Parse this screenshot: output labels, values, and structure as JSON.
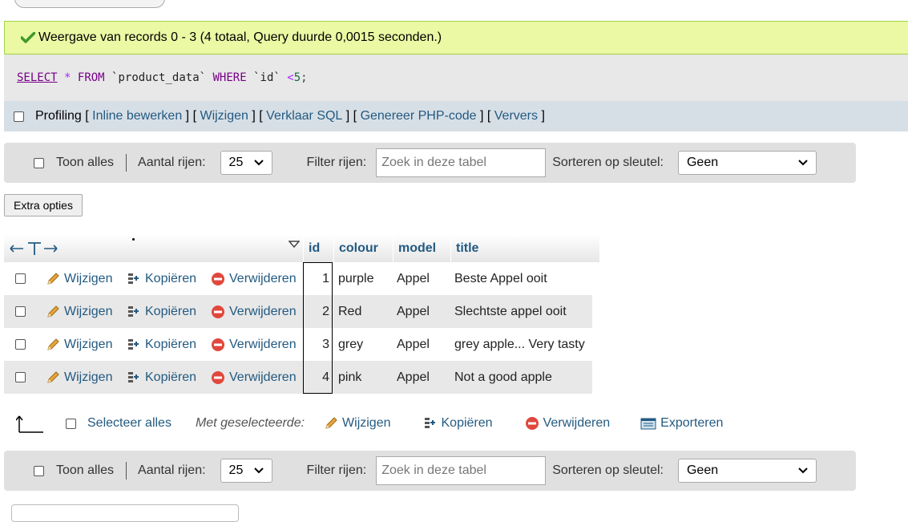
{
  "success": {
    "message": "Weergave van records 0 - 3 (4 totaal, Query duurde 0,0015 seconden.)"
  },
  "sql": {
    "select": "SELECT",
    "star": "*",
    "from": "FROM",
    "table": "`product_data`",
    "where": "WHERE",
    "column": "`id`",
    "operator": "<",
    "value": "5",
    "end": ";"
  },
  "profiling": {
    "label": "Profiling",
    "links": [
      "Inline bewerken",
      "Wijzigen",
      "Verklaar SQL",
      "Genereer PHP-code",
      "Ververs"
    ]
  },
  "nav": {
    "show_all": "Toon alles",
    "rows_label": "Aantal rijen:",
    "rows_value": "25",
    "filter_label": "Filter rijen:",
    "filter_placeholder": "Zoek in deze tabel",
    "sort_label": "Sorteren op sleutel:",
    "sort_value": "Geen"
  },
  "extra_options": "Extra opties",
  "table": {
    "columns": [
      "id",
      "colour",
      "model",
      "title"
    ],
    "actions": {
      "edit": "Wijzigen",
      "copy": "Kopiëren",
      "delete": "Verwijderen"
    },
    "rows": [
      {
        "id": "1",
        "colour": "purple",
        "model": "Appel",
        "title": "Beste Appel ooit"
      },
      {
        "id": "2",
        "colour": "Red",
        "model": "Appel",
        "title": "Slechtste appel ooit"
      },
      {
        "id": "3",
        "colour": "grey",
        "model": "Appel",
        "title": "grey apple... Very tasty"
      },
      {
        "id": "4",
        "colour": "pink",
        "model": "Appel",
        "title": "Not a good apple"
      }
    ]
  },
  "bulk": {
    "select_all": "Selecteer alles",
    "with_selected": "Met geselecteerde:",
    "edit": "Wijzigen",
    "copy": "Kopiëren",
    "delete": "Verwijderen",
    "export": "Exporteren"
  },
  "colors": {
    "link": "#235a81",
    "success_bg": "#ebf8a4",
    "delete": "#e0483d",
    "edit": "#d99a2b"
  }
}
